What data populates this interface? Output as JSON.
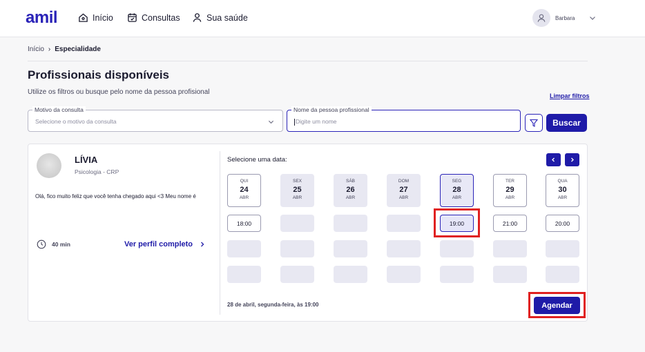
{
  "header": {
    "logo": "amil",
    "nav": [
      {
        "label": "Início",
        "icon": "home-icon"
      },
      {
        "label": "Consultas",
        "icon": "calendar-icon"
      },
      {
        "label": "Sua saúde",
        "icon": "person-icon"
      }
    ],
    "user_name": "Barbara"
  },
  "breadcrumb": {
    "home": "Início",
    "separator": "›",
    "current": "Especialidade"
  },
  "page": {
    "title": "Profissionais disponíveis",
    "subtitle": "Utilize os filtros ou busque pelo nome da pessoa profisional",
    "clear_filters": "Limpar filtros"
  },
  "filters": {
    "reason": {
      "label": "Motivo da consulta",
      "placeholder": "Selecione o motivo da consulta"
    },
    "name": {
      "label": "Nome da pessoa profissional",
      "placeholder": "Digite um nome"
    },
    "search_label": "Buscar"
  },
  "professional": {
    "name": "LÍVIA",
    "specialty": "Psicologia - CRP",
    "bio": "Olá, fico muito feliz que você tenha chegado aqui <3 Meu nome é",
    "duration": "40 min",
    "profile_link": "Ver perfil completo"
  },
  "scheduler": {
    "prompt": "Selecione uma data:",
    "days": [
      {
        "dow": "QUI",
        "num": "24",
        "mon": "ABR",
        "state": "enabled"
      },
      {
        "dow": "SEX",
        "num": "25",
        "mon": "ABR",
        "state": "disabled"
      },
      {
        "dow": "SÁB",
        "num": "26",
        "mon": "ABR",
        "state": "disabled"
      },
      {
        "dow": "DOM",
        "num": "27",
        "mon": "ABR",
        "state": "disabled"
      },
      {
        "dow": "SEG",
        "num": "28",
        "mon": "ABR",
        "state": "selected"
      },
      {
        "dow": "TER",
        "num": "29",
        "mon": "ABR",
        "state": "enabled"
      },
      {
        "dow": "QUA",
        "num": "30",
        "mon": "ABR",
        "state": "enabled"
      }
    ],
    "slots_row1": [
      "18:00",
      "",
      "",
      "",
      "19:00",
      "21:00",
      "20:00"
    ],
    "selected_slot_column": 4,
    "summary": "28 de abril, segunda-feira, às 19:00",
    "book_label": "Agendar"
  },
  "colors": {
    "primary": "#1f1ba8",
    "highlight": "#e02020"
  }
}
